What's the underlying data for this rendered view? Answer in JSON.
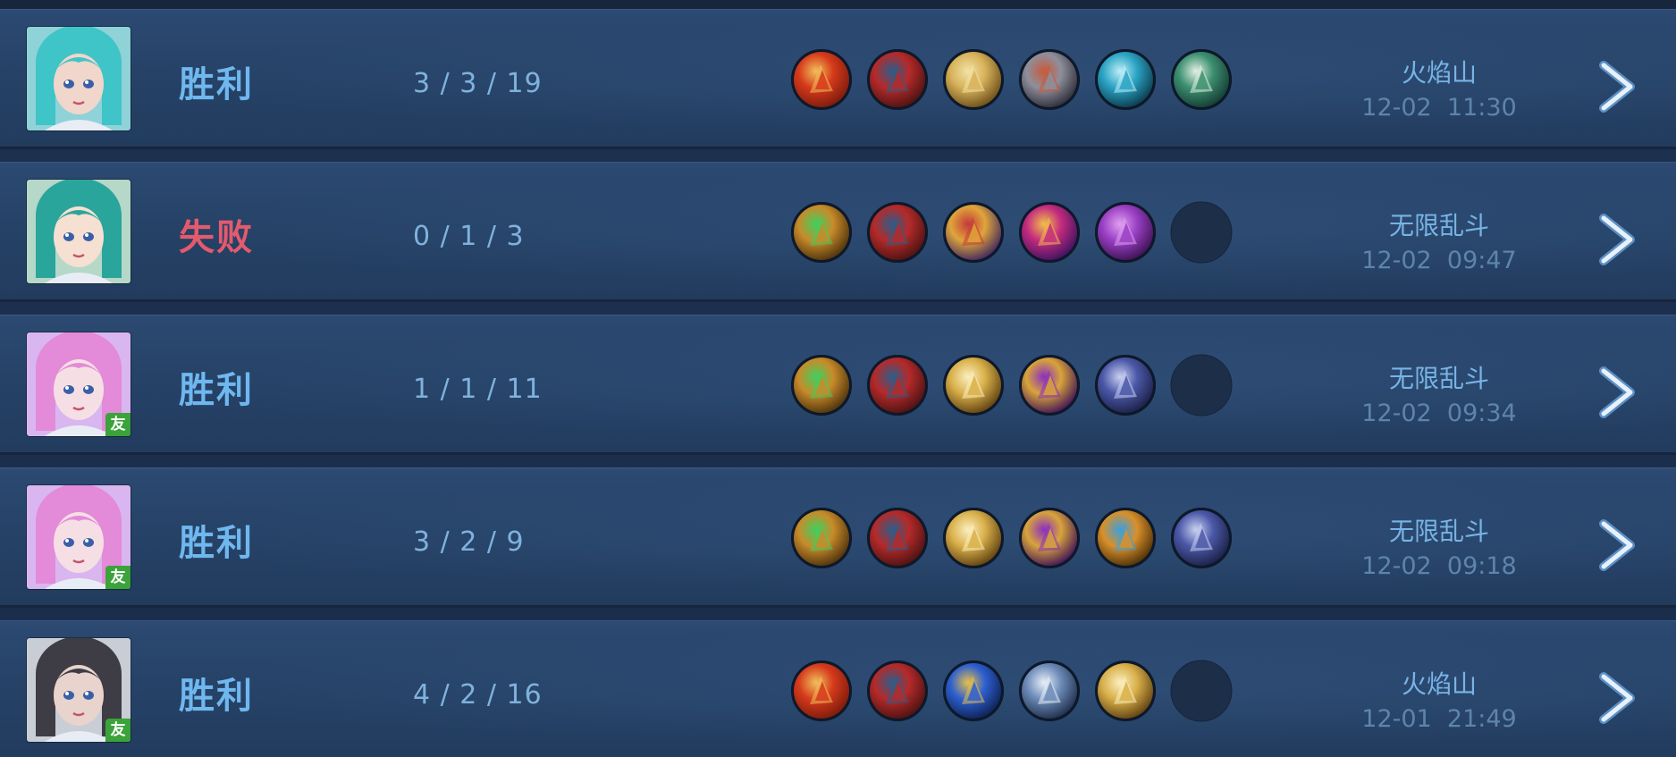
{
  "matches": [
    {
      "result": "胜利",
      "result_type": "win",
      "kda": "3 / 3 / 19",
      "mode": "火焰山",
      "time": "12-02  11:30",
      "friend": false,
      "avatar": {
        "hair": "#3fc4c7",
        "skin": "#f1d6cc",
        "bg": "#8fd2d8"
      },
      "items": [
        "flame-sword",
        "red-boots",
        "golden-cape",
        "silver-armor",
        "cyan-blade",
        "green-boots"
      ]
    },
    {
      "result": "失败",
      "result_type": "loss",
      "kda": "0 / 1 / 3",
      "mode": "无限乱斗",
      "time": "12-02  09:47",
      "friend": false,
      "avatar": {
        "hair": "#2aa59b",
        "skin": "#f6e0d2",
        "bg": "#b5d8c8"
      },
      "items": [
        "green-gem-staff",
        "red-boots",
        "golden-chalice",
        "magenta-orb",
        "purple-tome",
        "empty"
      ]
    },
    {
      "result": "胜利",
      "result_type": "win",
      "kda": "1 / 1 / 11",
      "mode": "无限乱斗",
      "time": "12-02  09:34",
      "friend": true,
      "friend_label": "友",
      "avatar": {
        "hair": "#e38ad8",
        "skin": "#f6dfe4",
        "bg": "#d9b6ef"
      },
      "items": [
        "green-gem-staff",
        "red-boots",
        "golden-hood",
        "purple-gold-hood",
        "violet-armor",
        "empty"
      ]
    },
    {
      "result": "胜利",
      "result_type": "win",
      "kda": "3 / 2 / 9",
      "mode": "无限乱斗",
      "time": "12-02  09:18",
      "friend": true,
      "friend_label": "友",
      "avatar": {
        "hair": "#e38ad8",
        "skin": "#f6dfe4",
        "bg": "#d9b6ef"
      },
      "items": [
        "green-gem-staff",
        "red-boots",
        "golden-hood",
        "purple-gold-hood",
        "golden-shield",
        "violet-armor"
      ]
    },
    {
      "result": "胜利",
      "result_type": "win",
      "kda": "4 / 2 / 16",
      "mode": "火焰山",
      "time": "12-01  21:49",
      "friend": true,
      "friend_label": "友",
      "avatar": {
        "hair": "#3e3c44",
        "skin": "#e8d4cc",
        "bg": "#c9cdd6"
      },
      "items": [
        "flame-sword",
        "red-boots",
        "blue-gauntlet",
        "silver-mask",
        "golden-hood",
        "empty"
      ]
    }
  ],
  "item_palette": {
    "flame-sword": [
      "#d63a1b",
      "#f0c05a",
      "#7a1a0c"
    ],
    "red-boots": [
      "#b52a2a",
      "#2c5d8a",
      "#4a1212"
    ],
    "golden-cape": [
      "#d7b25a",
      "#f3e2a5",
      "#6a4c18"
    ],
    "silver-armor": [
      "#8e8f9c",
      "#c85a3a",
      "#2b2c36"
    ],
    "cyan-blade": [
      "#2aa3c4",
      "#bfeef7",
      "#0b3848"
    ],
    "green-boots": [
      "#3c8f70",
      "#e1f0e2",
      "#143a32"
    ],
    "green-gem-staff": [
      "#c88b2a",
      "#3fd05e",
      "#4a300c"
    ],
    "golden-chalice": [
      "#e0a53a",
      "#c33a3a",
      "#3b2460"
    ],
    "magenta-orb": [
      "#c42b7e",
      "#f0c04a",
      "#3b1260"
    ],
    "purple-tome": [
      "#9a3fc4",
      "#e0a0f0",
      "#3a1250"
    ],
    "golden-hood": [
      "#d9b04a",
      "#fbefc0",
      "#5c3e10"
    ],
    "purple-gold-hood": [
      "#d8a43a",
      "#8a2fc0",
      "#3e1158"
    ],
    "violet-armor": [
      "#4b58a8",
      "#c9d0f0",
      "#1a1f44"
    ],
    "golden-shield": [
      "#d8902a",
      "#3aa0e0",
      "#4a2e08"
    ],
    "blue-gauntlet": [
      "#2d5fd0",
      "#e8c04a",
      "#0e2050"
    ],
    "silver-mask": [
      "#6c8bb8",
      "#e8eef8",
      "#1e2c48"
    ],
    "empty": [
      "#1c2e48",
      "#1c2e48",
      "#1c2e48"
    ]
  }
}
